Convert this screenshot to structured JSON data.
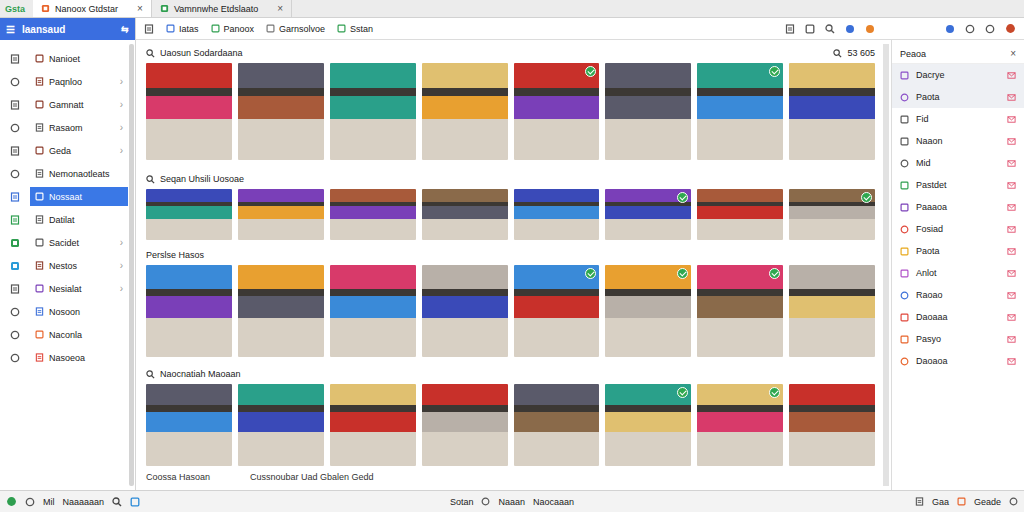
{
  "app_logo": "Gsta",
  "tabs": [
    {
      "label": "Nanoox Gtdstar",
      "close": "×",
      "selected": true,
      "color": "#e8632a"
    },
    {
      "label": "Vamnnwhe Etdslaato",
      "close": "×",
      "selected": false,
      "color": "#2e9e4f"
    }
  ],
  "sidebar": {
    "title": "Iaansaud",
    "menu_icon": "☰",
    "collapse_icon": "⇆",
    "items": [
      {
        "label": "Nanioet",
        "selected": false
      },
      {
        "label": "Paqnloo",
        "arrow": "›",
        "selected": false
      },
      {
        "label": "Gamnatt",
        "arrow": "›",
        "selected": false
      },
      {
        "label": "Rasaom",
        "arrow": "›",
        "selected": false
      },
      {
        "label": "Geda",
        "arrow": "›",
        "selected": false
      },
      {
        "label": "Nemonaotleats",
        "selected": false
      },
      {
        "label": "Nossaat",
        "selected": true
      },
      {
        "label": "Datilat",
        "selected": false
      },
      {
        "label": "Sacidet",
        "arrow": "›",
        "selected": false
      },
      {
        "label": "Nestos",
        "arrow": "›",
        "selected": false
      },
      {
        "label": "Nesialat",
        "arrow": "›",
        "selected": false
      },
      {
        "label": "Nosoon",
        "selected": false
      },
      {
        "label": "Naconla",
        "selected": false
      },
      {
        "label": "Nasoeoa",
        "selected": false
      }
    ]
  },
  "toolbar": {
    "items": [
      {
        "label": "Iatas",
        "color": "#3b6fd8"
      },
      {
        "label": "Panoox",
        "color": "#2e9e4f"
      },
      {
        "label": "Garnsolvoe",
        "color": "#777777"
      },
      {
        "label": "Sstan",
        "color": "#2e9e4f"
      }
    ]
  },
  "main": {
    "result_count": "53 605",
    "sections": [
      {
        "title": "Uaosun Sodardaana",
        "rows": [
          {
            "photos": [
              {
                "badge": false
              },
              {
                "badge": false
              },
              {
                "badge": false
              },
              {
                "badge": false
              },
              {
                "badge": true
              },
              {
                "badge": false
              },
              {
                "badge": true
              },
              {
                "badge": false
              }
            ]
          }
        ]
      },
      {
        "title": "Seqan Uhsili Uosoae",
        "rows": [
          {
            "photos": [
              {
                "badge": false
              },
              {
                "badge": false
              },
              {
                "badge": false
              },
              {
                "badge": false
              },
              {
                "badge": false
              },
              {
                "badge": true
              },
              {
                "badge": false
              },
              {
                "badge": true
              }
            ]
          },
          {
            "label": "Perslse Hasos",
            "photos": [
              {
                "badge": false
              },
              {
                "badge": false
              },
              {
                "badge": false
              },
              {
                "badge": false
              },
              {
                "badge": true
              },
              {
                "badge": true
              },
              {
                "badge": true
              },
              {
                "badge": false
              }
            ]
          }
        ]
      },
      {
        "title": "Naocnatiah Maoaan",
        "rows": [
          {
            "photos": [
              {
                "badge": false
              },
              {
                "badge": false
              },
              {
                "badge": false
              },
              {
                "badge": false
              },
              {
                "badge": false
              },
              {
                "badge": true
              },
              {
                "badge": true
              },
              {
                "badge": false
              }
            ]
          }
        ],
        "captions": [
          "Coossa Hasoan",
          "Cussnoubar Uad Gbalen Gedd"
        ]
      }
    ]
  },
  "right_panel": {
    "title": "Peaoa",
    "close": "×",
    "items": [
      {
        "label": "Dacrye",
        "color": "#8a4fc8",
        "selected": true
      },
      {
        "label": "Paota",
        "color": "#8a4fc8",
        "selected": true
      },
      {
        "label": "Fid",
        "color": "#555555",
        "selected": false
      },
      {
        "label": "Naaon",
        "color": "#555555",
        "selected": false
      },
      {
        "label": "Mid",
        "color": "#555555",
        "selected": false
      },
      {
        "label": "Pastdet",
        "color": "#2e9e4f",
        "selected": false
      },
      {
        "label": "Paaaoa",
        "color": "#7a3fb8",
        "selected": false
      },
      {
        "label": "Fosiad",
        "color": "#e0463a",
        "selected": false
      },
      {
        "label": "Paota",
        "color": "#e8a81a",
        "selected": false
      },
      {
        "label": "Anlot",
        "color": "#b04fc8",
        "selected": false
      },
      {
        "label": "Raoao",
        "color": "#3b6fd8",
        "selected": false
      },
      {
        "label": "Daoaaa",
        "color": "#e0463a",
        "selected": false
      },
      {
        "label": "Pasyo",
        "color": "#e8632a",
        "selected": false
      },
      {
        "label": "Daoaoa",
        "color": "#e8632a",
        "selected": false
      }
    ]
  },
  "status_bar": {
    "left": [
      "Mil",
      "Naaaaaan"
    ],
    "center": [
      "Sotan",
      "Naaan",
      "Naocaaan"
    ],
    "right": [
      "Gaa",
      "Geade"
    ]
  }
}
